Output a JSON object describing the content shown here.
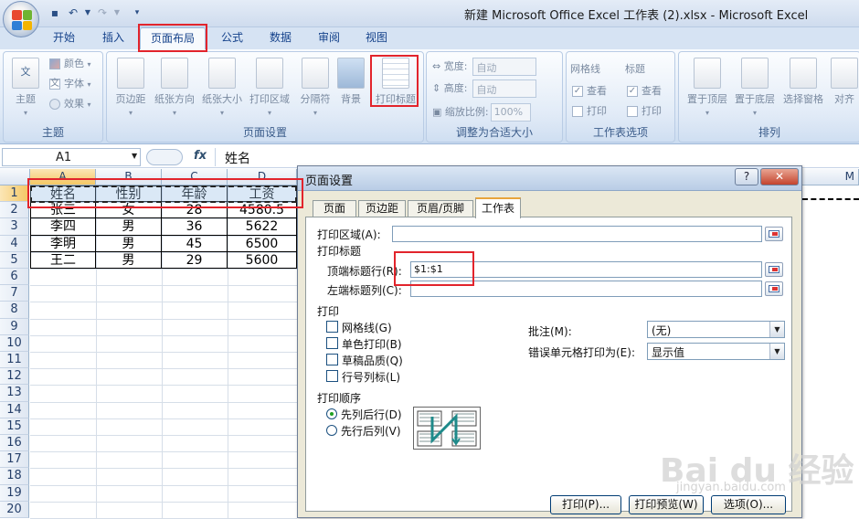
{
  "window": {
    "title": "新建 Microsoft Office Excel 工作表 (2).xlsx - Microsoft Excel"
  },
  "ribbon_tabs": [
    "开始",
    "插入",
    "页面布局",
    "公式",
    "数据",
    "审阅",
    "视图"
  ],
  "theme_group": {
    "label": "主题",
    "big_button": "主题",
    "items": [
      "颜色",
      "字体",
      "效果"
    ]
  },
  "page_setup_group": {
    "label": "页面设置",
    "buttons": [
      "页边距",
      "纸张方向",
      "纸张大小",
      "打印区域",
      "分隔符",
      "背景",
      "打印标题"
    ]
  },
  "scale_group": {
    "label": "调整为合适大小",
    "width_label": "宽度:",
    "width_value": "自动",
    "height_label": "高度:",
    "height_value": "自动",
    "scale_label": "缩放比例:",
    "scale_value": "100%"
  },
  "sheet_options_group": {
    "label": "工作表选项",
    "gridlines_title": "网格线",
    "headings_title": "标题",
    "view_label": "查看",
    "print_label": "打印"
  },
  "arrange_group": {
    "label": "排列",
    "buttons": [
      "置于顶层",
      "置于底层",
      "选择窗格",
      "对齐"
    ]
  },
  "formula_bar": {
    "name_box": "A1",
    "fx": "fx",
    "content": "姓名"
  },
  "sheet": {
    "columns": [
      "A",
      "B",
      "C",
      "D"
    ],
    "extra_column": "M",
    "row_numbers": [
      "1",
      "2",
      "3",
      "4",
      "5",
      "6",
      "7",
      "8",
      "9",
      "10",
      "11",
      "12",
      "13",
      "14",
      "15",
      "16",
      "17",
      "18",
      "19",
      "20"
    ],
    "rows": [
      [
        "姓名",
        "性别",
        "年龄",
        "工资"
      ],
      [
        "张三",
        "女",
        "28",
        "4580.5"
      ],
      [
        "李四",
        "男",
        "36",
        "5622"
      ],
      [
        "李明",
        "男",
        "45",
        "6500"
      ],
      [
        "王二",
        "男",
        "29",
        "5600"
      ]
    ]
  },
  "dialog": {
    "title": "页面设置",
    "help": "?",
    "close": "✕",
    "tabs": [
      "页面",
      "页边距",
      "页眉/页脚",
      "工作表"
    ],
    "print_area_label": "打印区域(A):",
    "print_titles_label": "打印标题",
    "top_rows_label": "顶端标题行(R):",
    "top_rows_value": "$1:$1",
    "left_cols_label": "左端标题列(C):",
    "print_section": "打印",
    "checkboxes": [
      "网格线(G)",
      "单色打印(B)",
      "草稿品质(Q)",
      "行号列标(L)"
    ],
    "comments_label": "批注(M):",
    "comments_value": "(无)",
    "errors_label": "错误单元格打印为(E):",
    "errors_value": "显示值",
    "order_label": "打印顺序",
    "order_options": [
      "先列后行(D)",
      "先行后列(V)"
    ],
    "buttons": [
      "打印(P)...",
      "打印预览(W)",
      "选项(O)..."
    ]
  },
  "watermark": {
    "text": "Bai du 经验",
    "url": "jingyan.baidu.com"
  }
}
